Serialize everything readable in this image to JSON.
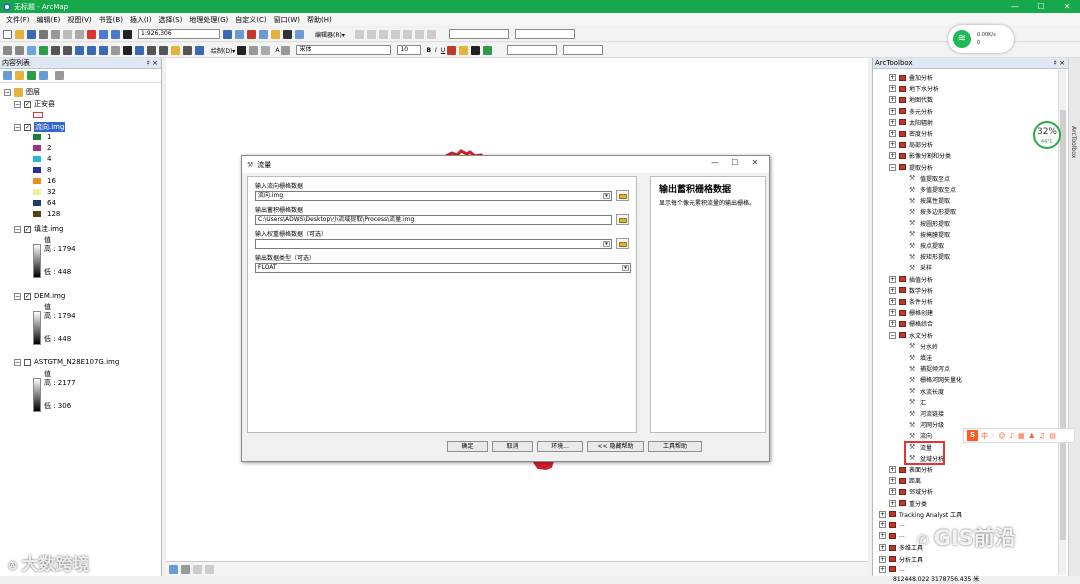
{
  "app": {
    "title": "无标题 - ArcMap",
    "window_controls": [
      "—",
      "☐",
      "✕"
    ]
  },
  "menu": [
    "文件(F)",
    "编辑(E)",
    "视图(V)",
    "书签(B)",
    "插入(I)",
    "选择(S)",
    "地理处理(G)",
    "自定义(C)",
    "窗口(W)",
    "帮助(H)"
  ],
  "toolbar": {
    "scale": "1:926,306",
    "editor_label": "编辑器(R)▾",
    "draw_label": "绘制(D)▾",
    "font_name": "宋体",
    "font_size": "10",
    "bold": "B",
    "italic": "I",
    "underline": "U",
    "text_tool": "A"
  },
  "network": {
    "speed": "0.00K/s",
    "count": "0"
  },
  "toc": {
    "title": "内容列表",
    "pin": "♯ ×",
    "root": "图层",
    "layer_zhengan": "正安县",
    "layer_flowdir": "流向.img",
    "flowdir_legend": [
      {
        "label": "1",
        "color": "#1a7f3a"
      },
      {
        "label": "2",
        "color": "#a0308a"
      },
      {
        "label": "4",
        "color": "#2ab3d8"
      },
      {
        "label": "8",
        "color": "#2b2f9e"
      },
      {
        "label": "16",
        "color": "#ee8b1e"
      },
      {
        "label": "32",
        "color": "#eef0a0"
      },
      {
        "label": "64",
        "color": "#1f3d6b"
      },
      {
        "label": "128",
        "color": "#544411"
      }
    ],
    "layer_fill": "填洼.img",
    "fill_value": "值",
    "fill_high": "高 : 1794",
    "fill_low": "低 : 448",
    "layer_dem": "DEM.img",
    "dem_value": "值",
    "dem_high": "高 : 1794",
    "dem_low": "低 : 448",
    "layer_aster": "ASTGTM_N28E107G.img",
    "aster_value": "值",
    "aster_high": "高 : 2177",
    "aster_low": "低 : 306"
  },
  "arctoolbox": {
    "title": "ArcToolbox",
    "pin": "♯ ×",
    "items": [
      "叠加分析",
      "地下水分析",
      "地图代数",
      "多元分析",
      "太阳辐射",
      "密度分析",
      "局部分析",
      "影像分割和分类",
      "提取分析"
    ],
    "extract_tools": [
      "值提取至点",
      "多值提取至点",
      "按属性提取",
      "按多边形提取",
      "按圆形提取",
      "按掩膜提取",
      "按点提取",
      "按矩形提取",
      "采样"
    ],
    "items2": [
      "插值分析",
      "数学分析",
      "条件分析",
      "栅格创建",
      "栅格综合",
      "水文分析"
    ],
    "hydro_tools": [
      "分水岭",
      "填洼",
      "捕捉倾泻点",
      "栅格河网矢量化",
      "水流长度",
      "汇",
      "河流链接",
      "河网分级",
      "流向",
      "流量",
      "盆域分析"
    ],
    "items3": [
      "表面分析",
      "距离",
      "邻域分析",
      "重分类"
    ],
    "bottom": [
      "Tracking Analyst 工具",
      "...",
      "...",
      "多维工具",
      "分析工具",
      "..."
    ],
    "side_tab": "ArcToolbox"
  },
  "dialog": {
    "title": "流量",
    "label_in_flowdir": "输入流向栅格数据",
    "value_in_flowdir": "流向.img",
    "label_out": "输出蓄积栅格数据",
    "value_out": "C:\\Users\\ADWS\\Desktop\\小流域提取\\Process\\流量.img",
    "label_weight": "输入权重栅格数据（可选）",
    "value_weight": "",
    "label_type": "输出数据类型（可选）",
    "value_type": "FLOAT",
    "help_title": "输出蓄积栅格数据",
    "help_text": "显示每个像元累积流量的输出栅格。",
    "buttons": {
      "ok": "确定",
      "cancel": "取消",
      "env": "环境...",
      "hide_help": "<< 隐藏帮助",
      "tool_help": "工具帮助"
    }
  },
  "status": {
    "coords": "812448.022  3178756.435 米"
  },
  "sogou": "S",
  "sogou_items": [
    "中",
    "·",
    "☺",
    "♪",
    "▦",
    "♟",
    "♫",
    "▤"
  ],
  "battery": {
    "percent": "32%",
    "temp": "44°C"
  },
  "watermarks": {
    "left": "大数跨境",
    "right": "GIS前沿"
  }
}
